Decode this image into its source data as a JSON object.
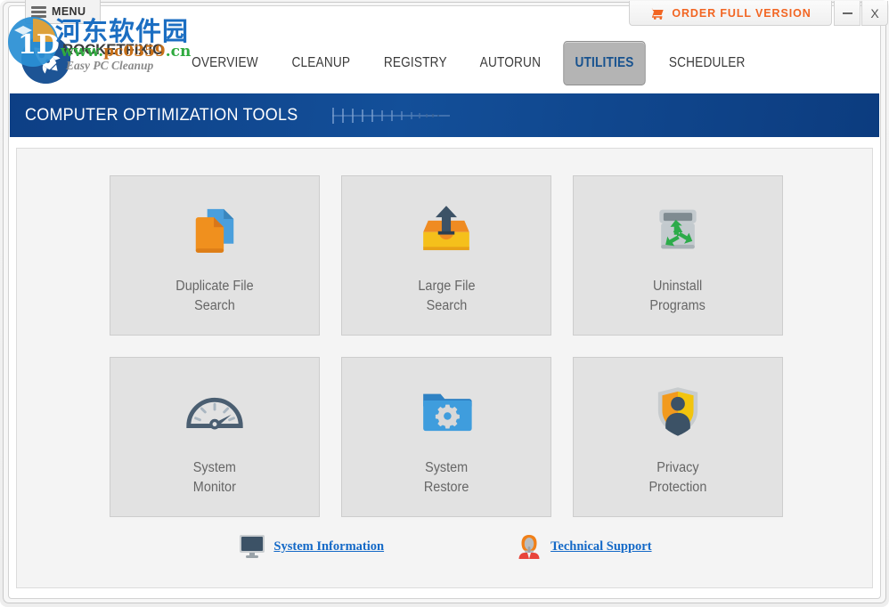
{
  "window": {
    "menu_label": "MENU",
    "menu_icon": "hamburger-icon",
    "order_label": "ORDER FULL VERSION",
    "order_icon": "shopping-cart-icon",
    "minimize_icon": "minimize-icon",
    "close_label": "X",
    "close_icon": "close-icon"
  },
  "brand": {
    "name": "ROCKETFIXIO",
    "tagline": "Easy PC Cleanup",
    "logo_icon": "rocket-logo-icon",
    "logo_color": "#1d5495"
  },
  "nav": {
    "tabs": [
      {
        "label": "OVERVIEW",
        "active": false
      },
      {
        "label": "CLEANUP",
        "active": false
      },
      {
        "label": "REGISTRY",
        "active": false
      },
      {
        "label": "AUTORUN",
        "active": false
      },
      {
        "label": "UTILITIES",
        "active": true
      },
      {
        "label": "SCHEDULER",
        "active": false
      }
    ],
    "active_tab": "UTILITIES",
    "active_color": "#17528f"
  },
  "header": {
    "title": "COMPUTER OPTIMIZATION TOOLS",
    "background_color": "#0d3f85",
    "decoration": "ruler-tick-decoration"
  },
  "tools": [
    {
      "line1": "Duplicate File",
      "line2": "Search",
      "icon": "duplicate-files-icon"
    },
    {
      "line1": "Large File",
      "line2": "Search",
      "icon": "large-file-tray-icon"
    },
    {
      "line1": "Uninstall",
      "line2": "Programs",
      "icon": "recycle-bin-icon"
    },
    {
      "line1": "System",
      "line2": "Monitor",
      "icon": "speedometer-icon"
    },
    {
      "line1": "System",
      "line2": "Restore",
      "icon": "folder-gear-icon"
    },
    {
      "line1": "Privacy",
      "line2": "Protection",
      "icon": "shield-person-icon"
    }
  ],
  "footer_links": [
    {
      "label": "System Information",
      "icon": "monitor-icon",
      "color": "#1469c7"
    },
    {
      "label": "Technical Support",
      "icon": "support-person-icon",
      "color": "#1469c7"
    }
  ],
  "watermark": {
    "text_cn": "河东软件园",
    "url_prefix": "www.",
    "url_main": "pc0359",
    "url_suffix": ".cn",
    "color_cn": "#1b6ec2",
    "color_url": "#2faa3f"
  }
}
